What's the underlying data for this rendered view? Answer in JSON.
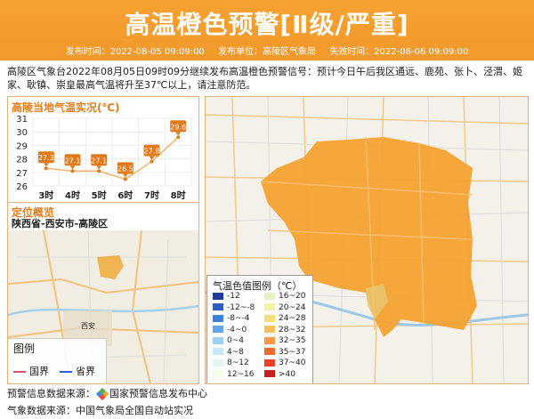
{
  "header": {
    "title": "高温橙色预警[Ⅱ级/严重]",
    "publish_time": "发布时间：2022-08-05 09:09:00",
    "publisher": "发布单位：高陵区气象局",
    "expire_time": "失效时间：2022-08-06 09:09:00"
  },
  "description": "高陵区气象台2022年08月05日09时09分继续发布高温橙色预警信号：预计今日午后我区通远、鹿苑、张卜、泾渭、姬家、耿镇、崇皇最高气温将升至37℃以上，请注意防范。",
  "chart_panel": {
    "title": "高陵当地气温实况(℃)"
  },
  "chart_data": {
    "type": "line",
    "title": "高陵当地气温实况(℃)",
    "categories": [
      "3时",
      "4时",
      "5时",
      "6时",
      "7时",
      "8时"
    ],
    "values": [
      27.3,
      27.1,
      27.1,
      26.5,
      27.8,
      29.6
    ],
    "y_ticks": [
      "31",
      "30",
      "29",
      "28",
      "27",
      "26"
    ],
    "ylim": [
      26,
      31
    ],
    "grid": true,
    "color": "#e07a1b"
  },
  "location": {
    "title": "定位概览",
    "text": "陕西省-西安市-高陵区"
  },
  "minimap": {
    "city_label": "西安",
    "legend_title": "图例",
    "legend_national": "国界",
    "legend_provincial": "省界",
    "national_color": "#e0506e",
    "provincial_color": "#2f5bd7"
  },
  "map_legend": {
    "title": "气温色值图例（℃）",
    "items": [
      {
        "label": "-12",
        "color": "#1f3c9a"
      },
      {
        "label": "-12~-8",
        "color": "#2b5fc2"
      },
      {
        "label": "-8~-4",
        "color": "#3c82d8"
      },
      {
        "label": "-4~0",
        "color": "#62a6e6"
      },
      {
        "label": "0~4",
        "color": "#9fcff2"
      },
      {
        "label": "4~8",
        "color": "#c7e8f6"
      },
      {
        "label": "8~12",
        "color": "#e6f6ec"
      },
      {
        "label": "12~16",
        "color": "#f7fbe9"
      },
      {
        "label": "16~20",
        "color": "#e4f2c1"
      },
      {
        "label": "20~24",
        "color": "#f3f1a6"
      },
      {
        "label": "24~28",
        "color": "#f7dd7c"
      },
      {
        "label": "28~32",
        "color": "#f6c260"
      },
      {
        "label": "32~35",
        "color": "#f49b4a"
      },
      {
        "label": "35~37",
        "color": "#ef6a30"
      },
      {
        "label": "37~40",
        "color": "#e2432a"
      },
      {
        "label": ">40",
        "color": "#c61f1f"
      }
    ]
  },
  "footer": {
    "warning_source": "预警信息数据来源：",
    "warning_source_name": "国家预警信息发布中心",
    "weather_source": "气象数据来源：中国气象局全国自动站实况"
  },
  "colors": {
    "accent": "#f39a2a",
    "heat_fill": "#f4a233"
  }
}
